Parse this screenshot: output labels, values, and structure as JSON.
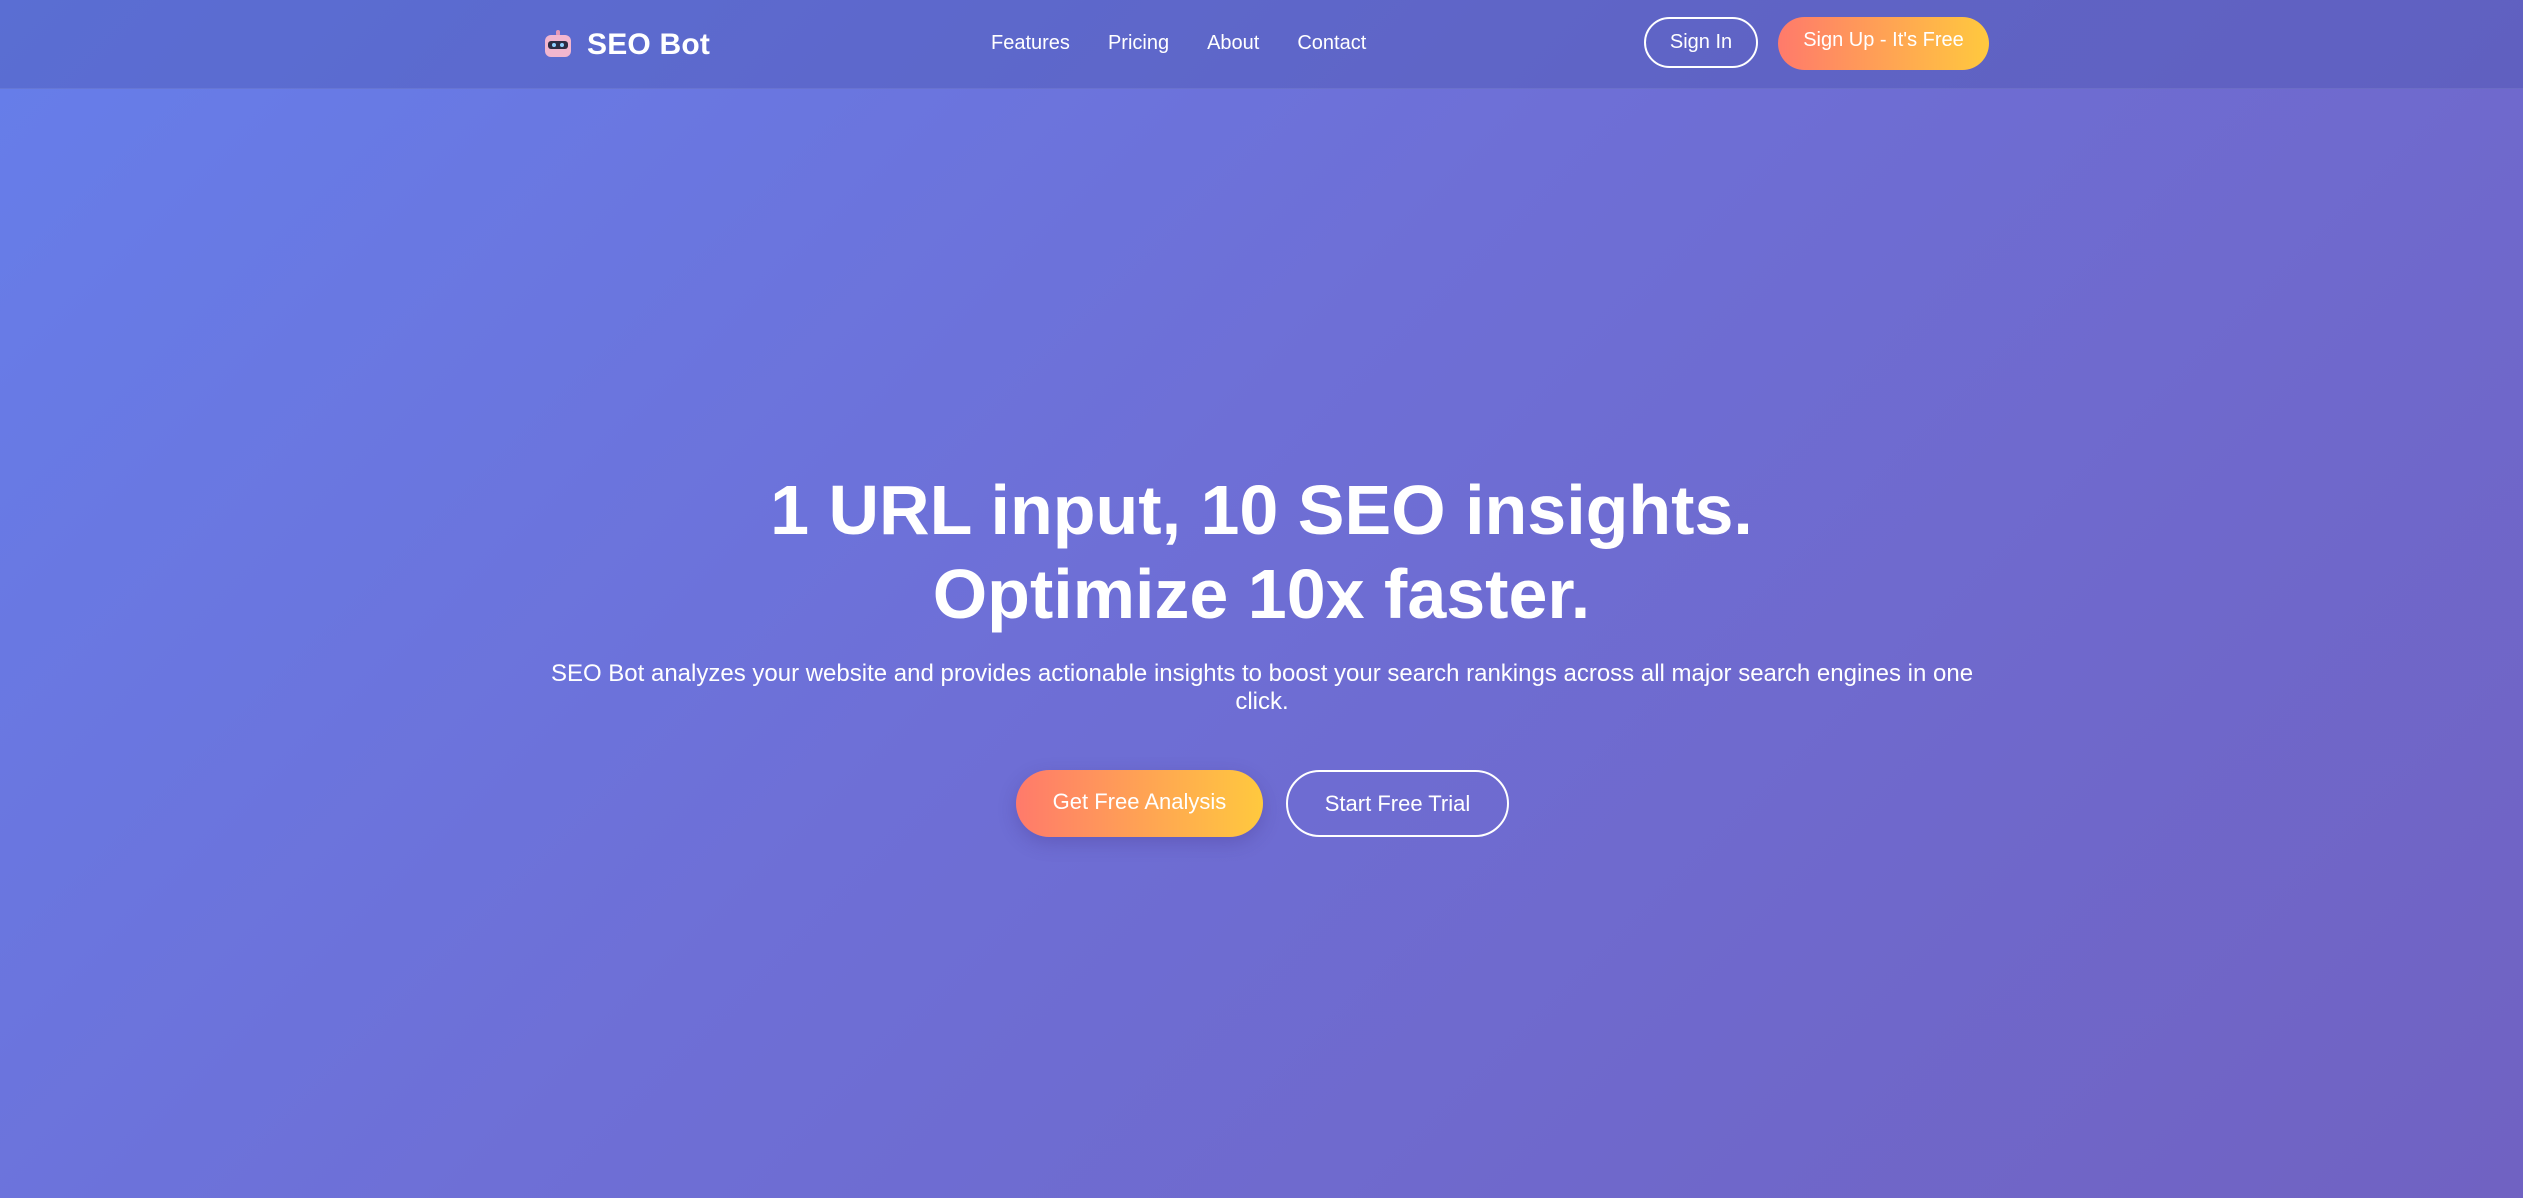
{
  "brand": {
    "name": "SEO Bot",
    "icon": "robot-icon"
  },
  "nav": {
    "links": [
      {
        "label": "Features"
      },
      {
        "label": "Pricing"
      },
      {
        "label": "About"
      },
      {
        "label": "Contact"
      }
    ],
    "signin_label": "Sign In",
    "signup_label": "Sign Up - It's Free"
  },
  "hero": {
    "title_line1": "1 URL input, 10 SEO insights.",
    "title_line2": "Optimize 10x faster.",
    "subtitle": "SEO Bot analyzes your website and provides actionable insights to boost your search rankings across all major search engines in one click.",
    "primary_cta": "Get Free Analysis",
    "secondary_cta": "Start Free Trial"
  },
  "colors": {
    "background_start": "#667eea",
    "background_end": "#764ba2",
    "cta_gradient_start": "#ff7a6b",
    "cta_gradient_end": "#ffc93e",
    "text": "#ffffff"
  }
}
